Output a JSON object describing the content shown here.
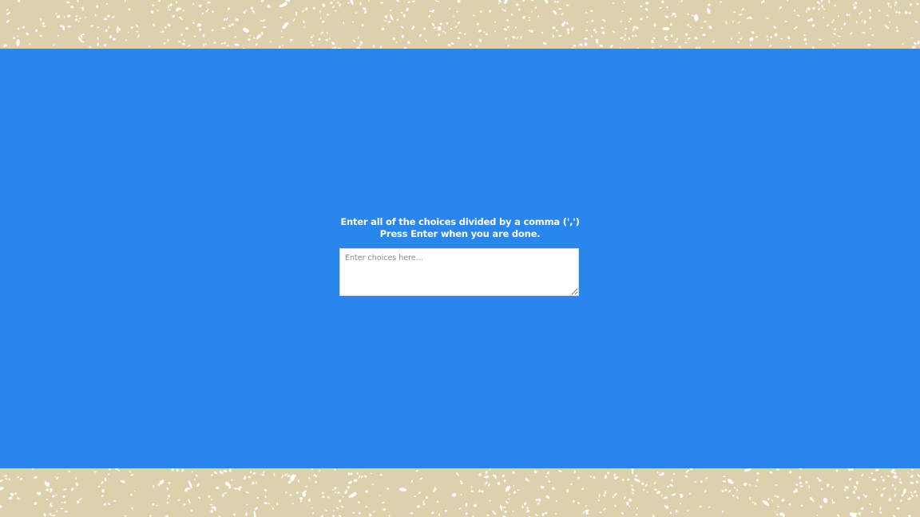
{
  "prompt": {
    "line1": "Enter all of the choices divided by a comma (',')",
    "line2": "Press Enter when you are done."
  },
  "choices_input": {
    "placeholder": "Enter choices here...",
    "value": ""
  },
  "colors": {
    "panel_background": "#2886ed",
    "border_background": "#ddd0ad",
    "speckle": "#ffffff",
    "text": "#ffffff"
  }
}
